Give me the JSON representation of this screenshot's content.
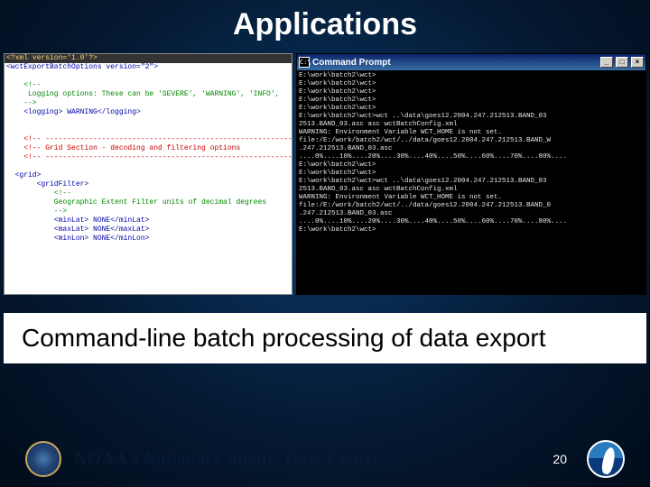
{
  "title": "Applications",
  "subtitle": "Command-line batch processing of data export",
  "pageNumber": "20",
  "footerText": "NOAA's National Climatic Data Center",
  "xml": {
    "l1": "<?xml version='1.0'?>",
    "l2": "<wctExportBatchOptions version=\"2\">",
    "l3": "    <!--",
    "l4": "     Logging options: These can be 'SEVERE', 'WARNING', 'INFO',",
    "l5": "    -->",
    "l6": "    <logging> WARNING</logging>",
    "l7": "    <!-- -----------------------------------------------------------",
    "l8": "    <!-- Grid Section - decoding and filtering options",
    "l9": "    <!-- -----------------------------------------------------------",
    "l10": "  <grid>",
    "l11": "       <gridFilter>",
    "l12": "           <!--",
    "l13": "           Geographic Extent Filter units of decimal degrees",
    "l14": "           -->",
    "l15": "           <minLat> NONE</minLat>",
    "l16": "           <maxLat> NONE</maxLat>",
    "l17": "           <minLon> NONE</minLon>"
  },
  "cmd": {
    "title": "Command Prompt",
    "min": "_",
    "max": "□",
    "close": "×",
    "icon": "C:\\",
    "lines": [
      "E:\\work\\batch2\\wct>",
      "E:\\work\\batch2\\wct>",
      "E:\\work\\batch2\\wct>",
      "E:\\work\\batch2\\wct>",
      "E:\\work\\batch2\\wct>",
      "E:\\work\\batch2\\wct>wct ..\\data\\goes12.2004.247.212513.BAND_03",
      "2513.BAND_03.asc asc wctBatchConfig.xml",
      "WARNING: Environment Variable WCT_HOME is not set.",
      "file:/E:/work/batch2/wct/../data/goes12.2004.247.212513.BAND_W",
      ".247.212513.BAND_03.asc",
      "....0%....10%....20%....30%....40%....50%....60%....70%....80%....",
      "",
      "E:\\work\\batch2\\wct>",
      "E:\\work\\batch2\\wct>",
      "E:\\work\\batch2\\wct>wct ..\\data\\goes12.2004.247.212513.BAND_03",
      "2513.BAND_03.asc asc wctBatchConfig.xml",
      "WARNING: Environment Variable WCT_HOME is not set.",
      "file:/E:/work/batch2/wct/../data/goes12.2004.247.212513.BAND_0",
      ".247.212513.BAND_03.asc",
      "....0%....10%....20%....30%....40%....50%....60%....70%....80%....",
      "",
      "E:\\work\\batch2\\wct>"
    ]
  }
}
